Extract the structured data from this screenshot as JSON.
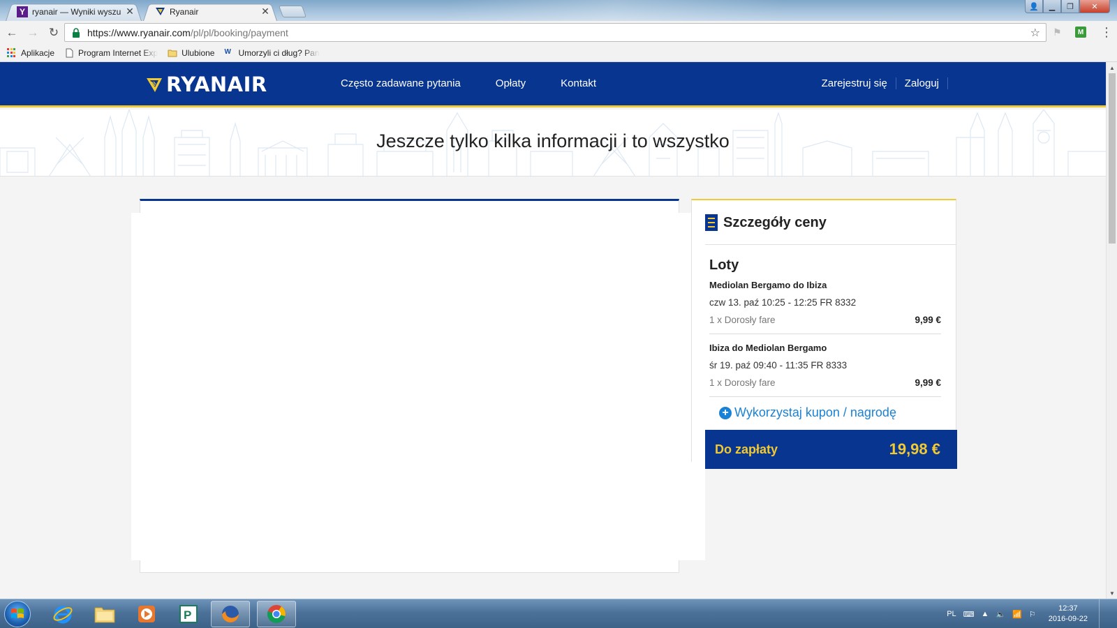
{
  "browser": {
    "tabs": [
      {
        "title": "ryanair — Wyniki wyszuk"
      },
      {
        "title": "Ryanair"
      }
    ],
    "url_host": "https://www.ryanair.com",
    "url_path": "/pl/pl/booking/payment",
    "bookmarks": [
      {
        "label": "Aplikacje"
      },
      {
        "label": "Program Internet Exp"
      },
      {
        "label": "Ulubione"
      },
      {
        "label": "Umorzyli ci dług? Pan"
      }
    ]
  },
  "header": {
    "logo": "RYANAIR",
    "nav": [
      "Często zadawane pytania",
      "Opłaty",
      "Kontakt"
    ],
    "register": "Zarejestruj się",
    "login": "Zaloguj"
  },
  "hero": {
    "title": "Jeszcze tylko kilka informacji i to wszystko"
  },
  "price": {
    "title": "Szczegóły ceny",
    "section": "Loty",
    "flights": [
      {
        "route": "Mediolan Bergamo do Ibiza",
        "time": "czw 13. paź 10:25 - 12:25 FR 8332",
        "fare_label": "1 x Dorosły fare",
        "fare_amount": "9,99 €"
      },
      {
        "route": "Ibiza do Mediolan Bergamo",
        "time": "śr 19. paź 09:40 - 11:35 FR 8333",
        "fare_label": "1 x Dorosły fare",
        "fare_amount": "9,99 €"
      }
    ],
    "coupon": "Wykorzystaj kupon / nagrodę",
    "total_label": "Do zapłaty",
    "total_amount": "19,98 €"
  },
  "taskbar": {
    "lang": "PL",
    "time": "12:37",
    "date": "2016-09-22"
  },
  "colors": {
    "brand_blue": "#073590",
    "brand_yellow": "#f1c933",
    "link_blue": "#1a82d6"
  }
}
